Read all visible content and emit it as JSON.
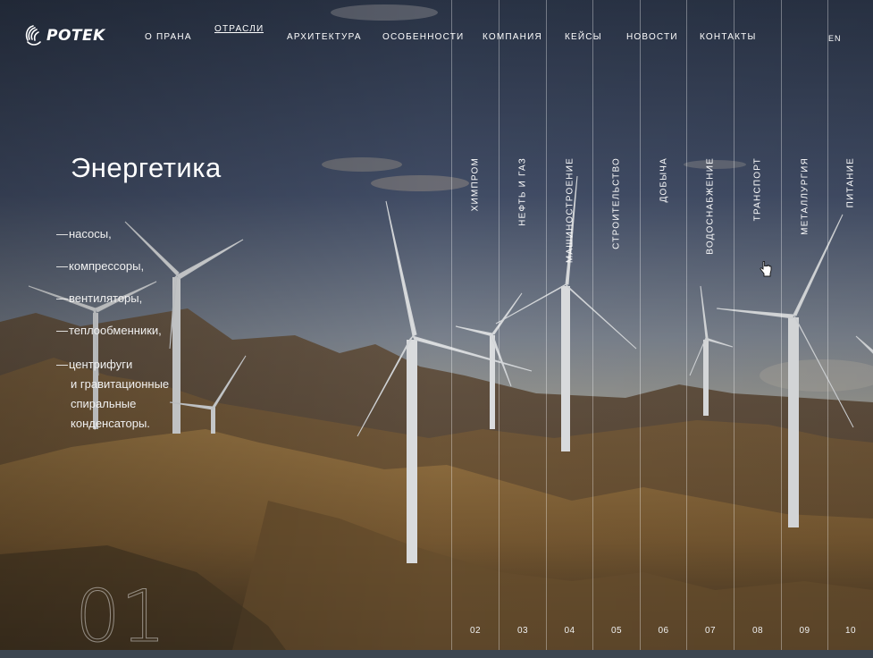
{
  "header": {
    "logo_text": "POTEK",
    "nav": [
      {
        "label": "О ПРАНА",
        "active": false
      },
      {
        "label": "ОТРАСЛИ",
        "active": true
      },
      {
        "label": "АРХИТЕКТУРА",
        "active": false
      },
      {
        "label": "ОСОБЕННОСТИ",
        "active": false
      },
      {
        "label": "КОМПАНИЯ",
        "active": false
      },
      {
        "label": "КЕЙСЫ",
        "active": false
      },
      {
        "label": "НОВОСТИ",
        "active": false
      },
      {
        "label": "КОНТАКТЫ",
        "active": false
      }
    ],
    "lang": "EN"
  },
  "industry": {
    "title": "Энергетика",
    "number": "01",
    "items": [
      "насосы,",
      "компрессоры,",
      "вентиляторы,",
      "теплообменники,"
    ],
    "multi_item": {
      "first": "центрифуги",
      "rest": [
        "и гравитационные",
        "спиральные",
        "конденсаторы."
      ]
    }
  },
  "columns": [
    {
      "label": "ХИМПРОМ",
      "num": "02"
    },
    {
      "label": "НЕФТЬ И ГАЗ",
      "num": "03"
    },
    {
      "label": "МАШИНОСТРОЕНИЕ",
      "num": "04"
    },
    {
      "label": "СТРОИТЕЛЬСТВО",
      "num": "05"
    },
    {
      "label": "ДОБЫЧА",
      "num": "06"
    },
    {
      "label": "ВОДОСНАБЖЕНИЕ",
      "num": "07"
    },
    {
      "label": "ТРАНСПОРТ",
      "num": "08"
    },
    {
      "label": "МЕТАЛЛУРГИЯ",
      "num": "09"
    },
    {
      "label": "ПИТАНИЕ",
      "num": "10"
    }
  ],
  "colors": {
    "sky_top": "#2f3a4c",
    "sky_bottom": "#8a8f93",
    "hill_near": "#8c6a3c",
    "hill_far": "#5e4a35"
  }
}
